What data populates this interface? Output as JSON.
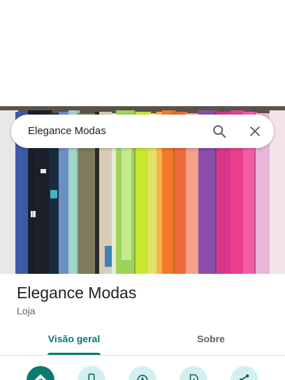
{
  "search": {
    "query": "Elegance Modas"
  },
  "place": {
    "name": "Elegance Modas",
    "category": "Loja"
  },
  "tabs": [
    {
      "label": "Visão geral",
      "active": true
    },
    {
      "label": "Sobre",
      "active": false
    }
  ],
  "actions": [
    {
      "icon": "directions-icon",
      "style": "primary"
    },
    {
      "icon": "phone-icon",
      "style": "secondary"
    },
    {
      "icon": "navigation-icon",
      "style": "secondary"
    },
    {
      "icon": "save-icon",
      "style": "secondary"
    },
    {
      "icon": "share-icon",
      "style": "secondary"
    }
  ],
  "colors": {
    "accent": "#00796b",
    "action_primary": "#0b7a70",
    "action_secondary": "#d2f0ee"
  }
}
